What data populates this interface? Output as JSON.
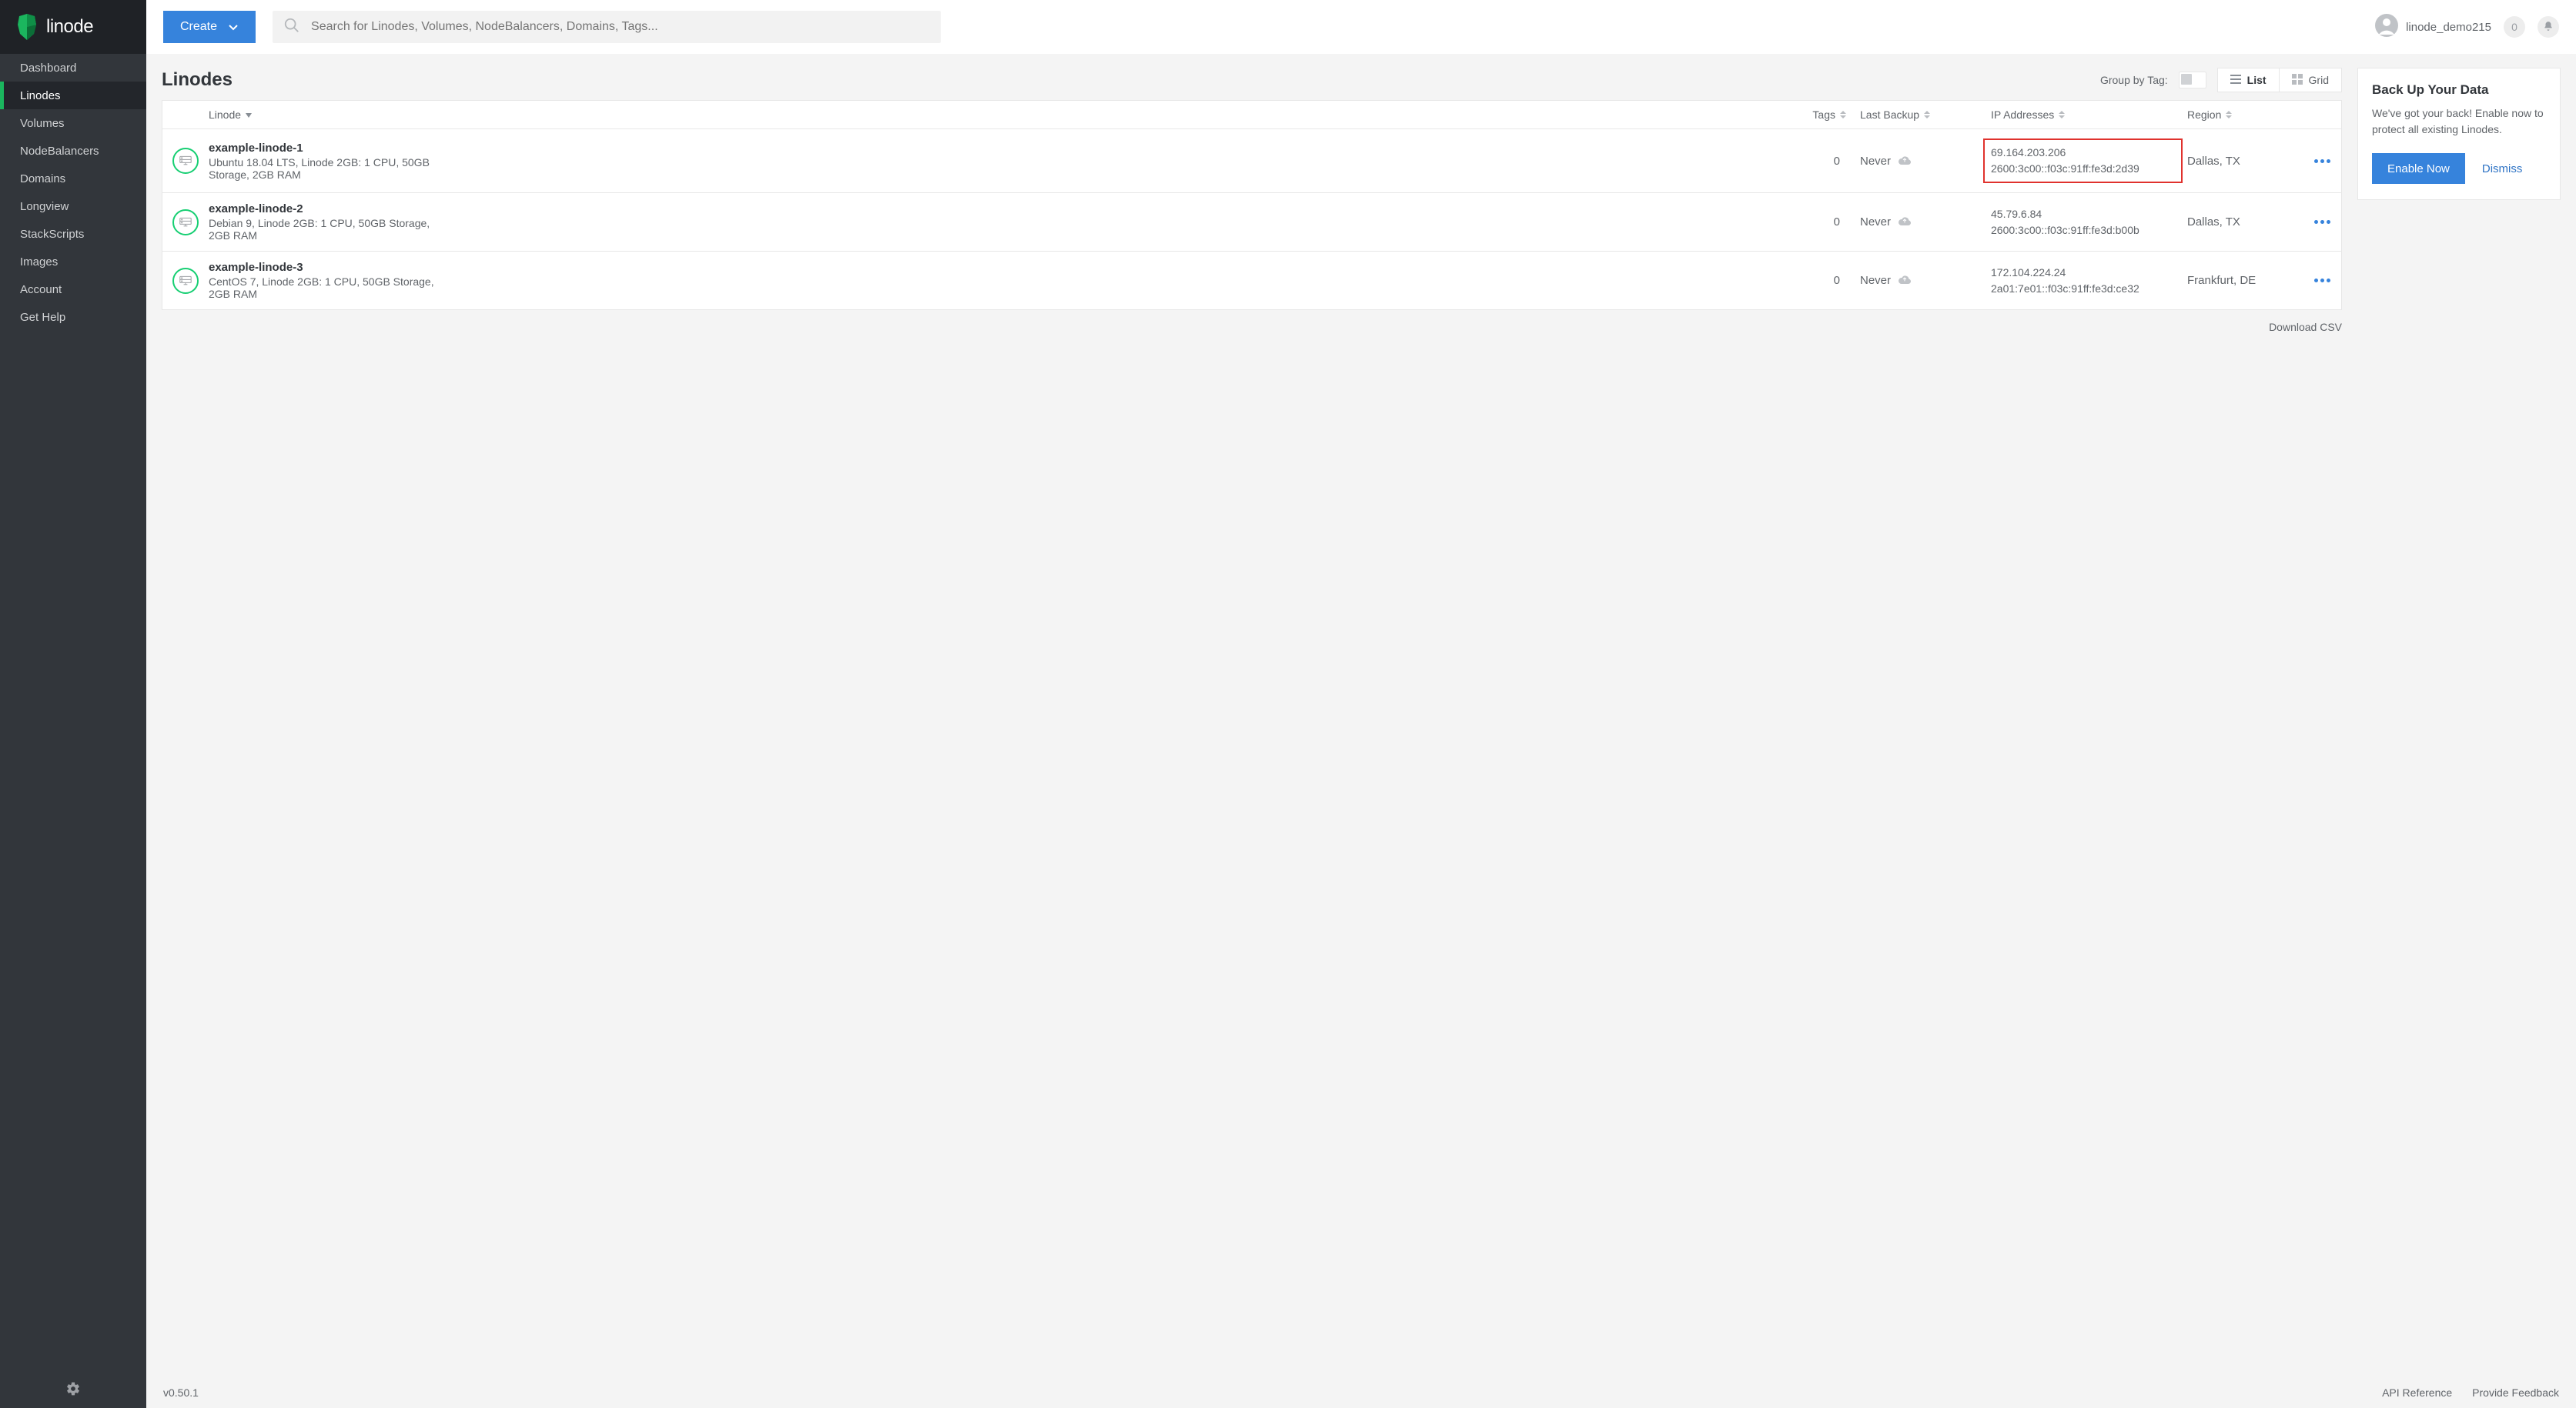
{
  "brand": {
    "name": "linode"
  },
  "sidebar": {
    "items": [
      {
        "label": "Dashboard"
      },
      {
        "label": "Linodes"
      },
      {
        "label": "Volumes"
      },
      {
        "label": "NodeBalancers"
      },
      {
        "label": "Domains"
      },
      {
        "label": "Longview"
      },
      {
        "label": "StackScripts"
      },
      {
        "label": "Images"
      },
      {
        "label": "Account"
      },
      {
        "label": "Get Help"
      }
    ]
  },
  "topbar": {
    "create_label": "Create",
    "search_placeholder": "Search for Linodes, Volumes, NodeBalancers, Domains, Tags...",
    "username": "linode_demo215",
    "notification_count": "0"
  },
  "page": {
    "title": "Linodes",
    "group_by_tag_label": "Group by Tag:",
    "view_list_label": "List",
    "view_grid_label": "Grid",
    "download_csv_label": "Download CSV"
  },
  "columns": {
    "linode": "Linode",
    "tags": "Tags",
    "last_backup": "Last Backup",
    "ip": "IP Addresses",
    "region": "Region"
  },
  "rows": [
    {
      "name": "example-linode-1",
      "sub": "Ubuntu 18.04 LTS, Linode 2GB: 1 CPU, 50GB Storage, 2GB RAM",
      "tags": "0",
      "backup": "Never",
      "ipv4": "69.164.203.206",
      "ipv6": "2600:3c00::f03c:91ff:fe3d:2d39",
      "region": "Dallas, TX",
      "highlight_ip": true
    },
    {
      "name": "example-linode-2",
      "sub": "Debian 9, Linode 2GB: 1 CPU, 50GB Storage, 2GB RAM",
      "tags": "0",
      "backup": "Never",
      "ipv4": "45.79.6.84",
      "ipv6": "2600:3c00::f03c:91ff:fe3d:b00b",
      "region": "Dallas, TX",
      "highlight_ip": false
    },
    {
      "name": "example-linode-3",
      "sub": "CentOS 7, Linode 2GB: 1 CPU, 50GB Storage, 2GB RAM",
      "tags": "0",
      "backup": "Never",
      "ipv4": "172.104.224.24",
      "ipv6": "2a01:7e01::f03c:91ff:fe3d:ce32",
      "region": "Frankfurt, DE",
      "highlight_ip": false
    }
  ],
  "promo": {
    "title": "Back Up Your Data",
    "body": "We've got your back! Enable now to protect all existing Linodes.",
    "enable_label": "Enable Now",
    "dismiss_label": "Dismiss"
  },
  "footer": {
    "version": "v0.50.1",
    "api_ref": "API Reference",
    "feedback": "Provide Feedback"
  }
}
